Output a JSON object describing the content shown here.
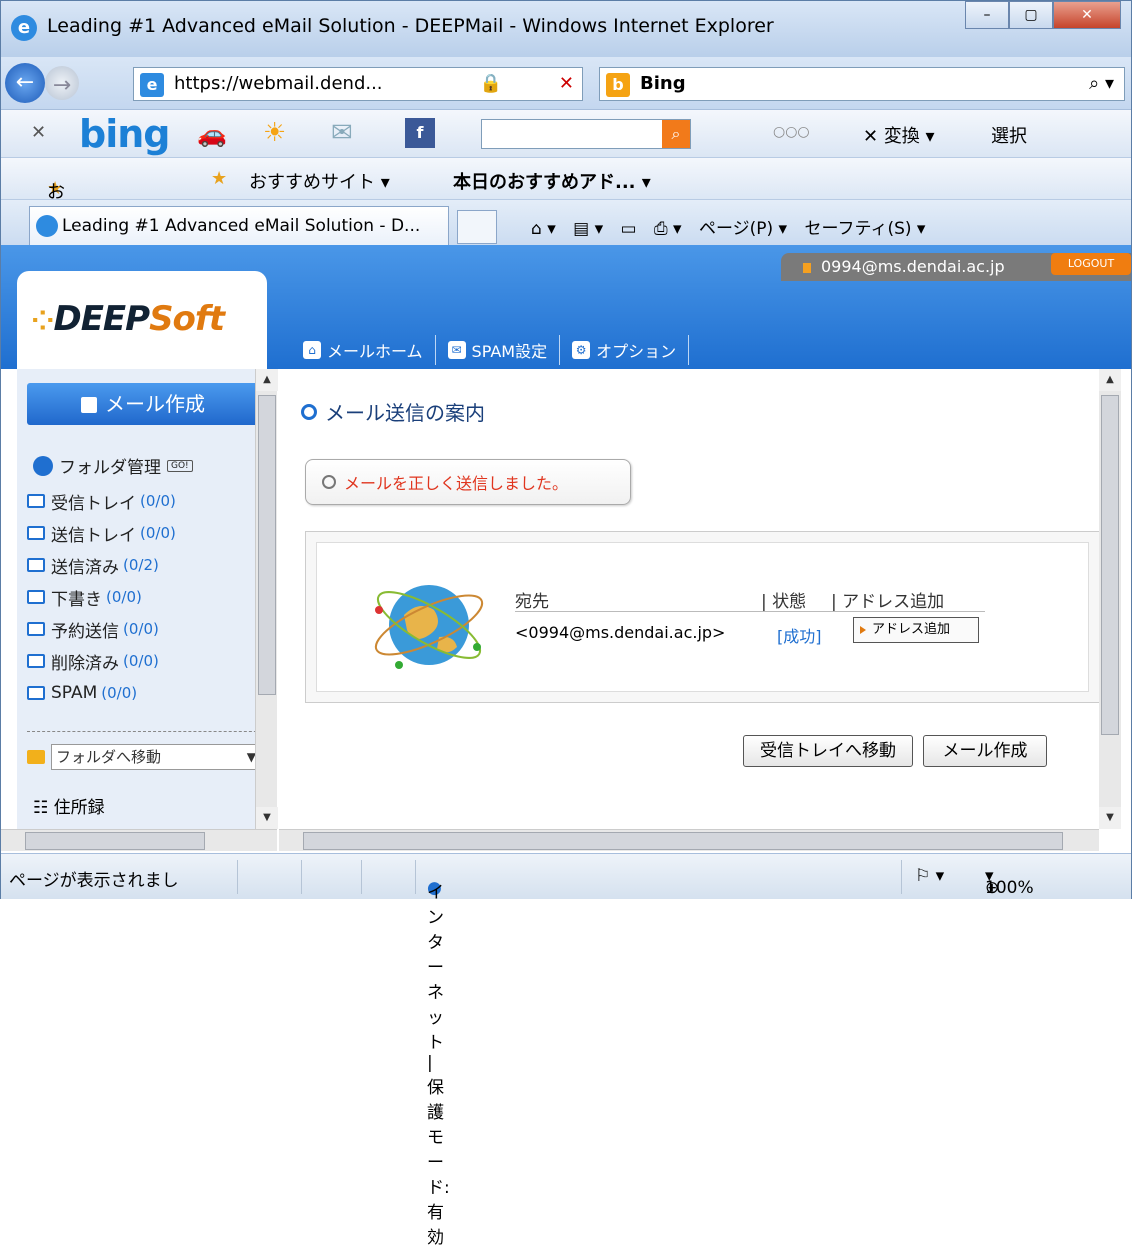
{
  "window": {
    "title": "Leading #1 Advanced eMail Solution - DEEPMail - Windows Internet Explorer",
    "min": "–",
    "max": "▢",
    "close": "✕"
  },
  "address": {
    "url_main": "https://webmail.dend...",
    "search_provider": "Bing"
  },
  "bing_bar": {
    "logo": "bing",
    "more": "○○○",
    "translate": "変換",
    "select": "選択"
  },
  "favorites": {
    "fav": "お気に入り",
    "suggested": "おすすめサイト ▾",
    "addon": "本日のおすすめアド... ▾"
  },
  "tab": {
    "label": "Leading #1 Advanced eMail Solution - D..."
  },
  "command_bar": {
    "page": "ページ(P) ▾",
    "safety": "セーフティ(S) ▾"
  },
  "app": {
    "logo_main": "DEEP",
    "logo_accent": "Soft",
    "user": "0994@ms.dendai.ac.jp",
    "logout": "LOGOUT",
    "nav": [
      "メールホーム",
      "SPAM設定",
      "オプション"
    ]
  },
  "sidebar": {
    "compose": "メール作成",
    "folder_mgmt": "フォルダ管理",
    "go": "GO!",
    "folders": [
      {
        "name": "受信トレイ",
        "count": "(0/0)"
      },
      {
        "name": "送信トレイ",
        "count": "(0/0)"
      },
      {
        "name": "送信済み",
        "count": "(0/2)"
      },
      {
        "name": "下書き",
        "count": "(0/0)"
      },
      {
        "name": "予約送信",
        "count": "(0/0)"
      },
      {
        "name": "削除済み",
        "count": "(0/0)"
      },
      {
        "name": "SPAM",
        "count": "(0/0)"
      }
    ],
    "move_select": "フォルダへ移動",
    "address_book": "住所録"
  },
  "main": {
    "title": "メール送信の案内",
    "notice": "メールを正しく送信しました。",
    "table_headers": {
      "to": "宛先",
      "status": "| 状態",
      "add": "| アドレス追加"
    },
    "row": {
      "to": "<0994@ms.dendai.ac.jp>",
      "status": "[成功]",
      "add": "アドレス追加"
    },
    "btn_inbox": "受信トレイへ移動",
    "btn_compose": "メール作成"
  },
  "statusbar": {
    "text": "ページが表示されまし",
    "zone": "インターネット | 保護モード: 有効",
    "zoom": "100%"
  }
}
